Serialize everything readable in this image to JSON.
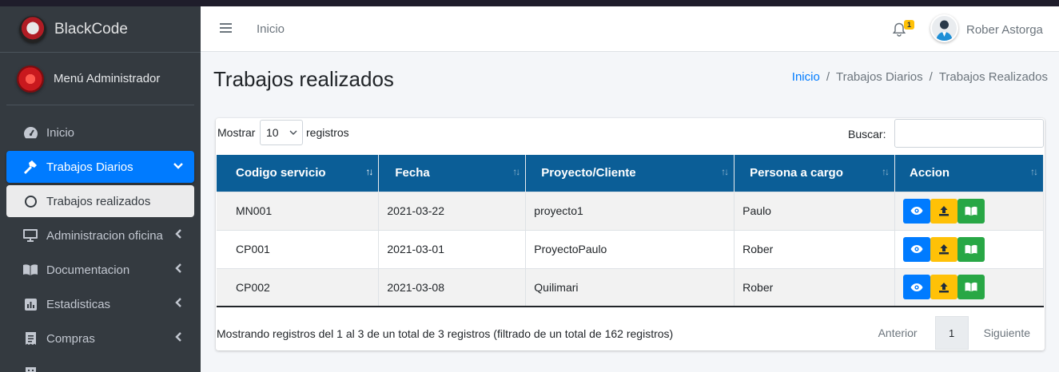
{
  "brand": {
    "name": "BlackCode"
  },
  "sidebar": {
    "user_name": "Menú Administrador",
    "items": [
      {
        "label": "Inicio",
        "icon": "tachometer-icon"
      },
      {
        "label": "Trabajos Diarios",
        "icon": "hammer-icon"
      },
      {
        "label": "Trabajos realizados",
        "icon": "circle-icon"
      },
      {
        "label": "Administracion oficina",
        "icon": "desktop-icon"
      },
      {
        "label": "Documentacion",
        "icon": "book-icon"
      },
      {
        "label": "Estadisticas",
        "icon": "bar-chart-icon"
      },
      {
        "label": "Compras",
        "icon": "receipt-icon"
      }
    ]
  },
  "header": {
    "home_link": "Inicio",
    "notification_count": "1",
    "user_name": "Rober Astorga"
  },
  "page": {
    "title": "Trabajos realizados",
    "breadcrumb": [
      "Inicio",
      "Trabajos Diarios",
      "Trabajos Realizados"
    ]
  },
  "table_controls": {
    "show_label": "Mostrar",
    "page_size": "10",
    "records_label": "registros",
    "search_label": "Buscar:",
    "search_value": ""
  },
  "table": {
    "columns": [
      "Codigo servicio",
      "Fecha",
      "Proyecto/Cliente",
      "Persona a cargo",
      "Accion"
    ],
    "rows": [
      {
        "code": "MN001",
        "date": "2021-03-22",
        "project": "proyecto1",
        "person": "Paulo"
      },
      {
        "code": "CP001",
        "date": "2021-03-01",
        "project": "ProyectoPaulo",
        "person": "Rober"
      },
      {
        "code": "CP002",
        "date": "2021-03-08",
        "project": "Quilimari",
        "person": "Rober"
      }
    ]
  },
  "footer": {
    "info": "Mostrando registros del 1 al 3 de un total de 3 registros (filtrado de un total de 162 registros)",
    "prev": "Anterior",
    "page": "1",
    "next": "Siguiente"
  },
  "colors": {
    "primary": "#007bff",
    "sidebar_bg": "#343a40",
    "table_header": "#0b5e97",
    "warning": "#ffc107",
    "success": "#28a745"
  }
}
